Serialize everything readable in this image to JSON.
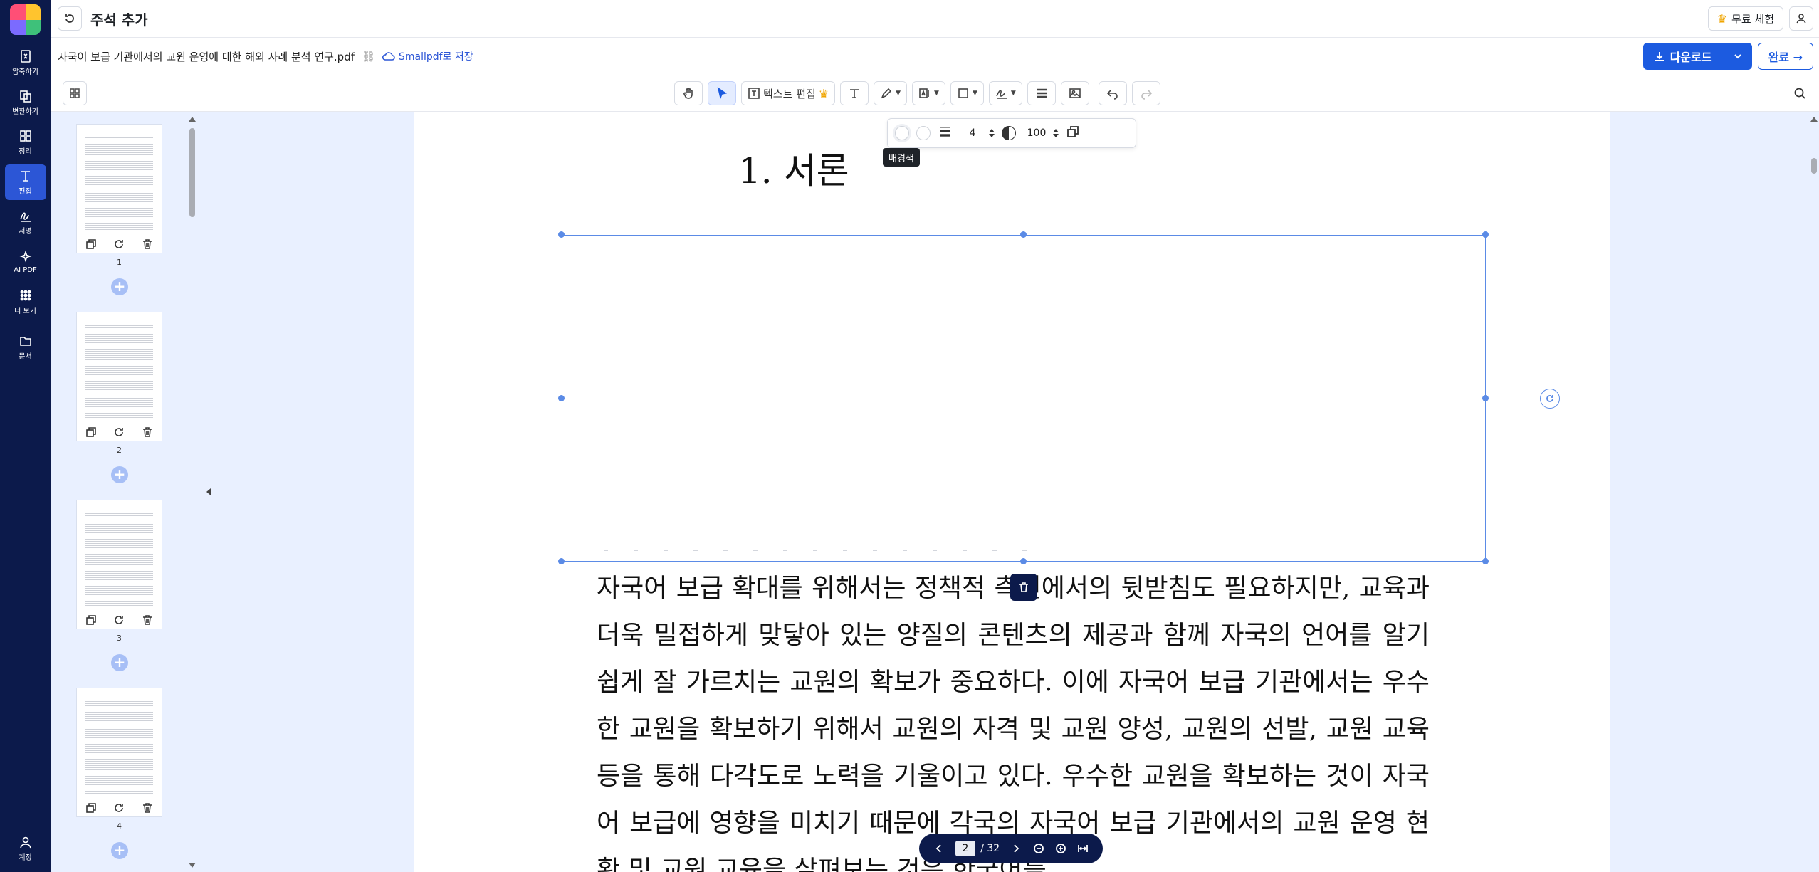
{
  "app": {
    "title": "주석 추가",
    "trial_label": "무료 체험"
  },
  "nav": {
    "items": [
      {
        "label": "압축하기",
        "icon": "compress-icon"
      },
      {
        "label": "변환하기",
        "icon": "convert-icon"
      },
      {
        "label": "정리",
        "icon": "organize-icon"
      },
      {
        "label": "편집",
        "icon": "edit-icon",
        "active": true
      },
      {
        "label": "서명",
        "icon": "sign-icon"
      },
      {
        "label": "AI PDF",
        "icon": "ai-icon"
      },
      {
        "label": "더 보기",
        "icon": "more-icon"
      },
      {
        "label": "문서",
        "icon": "folder-icon"
      }
    ],
    "account_label": "계정"
  },
  "file": {
    "name": "자국어 보급 기관에서의 교원 운영에 대한 해외 사례 분석 연구.pdf",
    "save_label": "Smallpdf로 저장",
    "download_label": "다운로드",
    "done_label": "완료 →"
  },
  "toolbar": {
    "edit_text_label": "텍스트 편집"
  },
  "style_bar": {
    "stroke_width": "4",
    "opacity": "100",
    "tooltip": "배경색"
  },
  "thumbnails": [
    {
      "number": "1"
    },
    {
      "number": "2"
    },
    {
      "number": "3"
    },
    {
      "number": "4"
    }
  ],
  "document": {
    "heading": "1.  서론",
    "paragraph": "자국어 보급 확대를 위해서는 정책적 측면에서의 뒷받침도 필요하지만, 교육과 더욱 밀접하게 맞닿아 있는 양질의 콘텐츠의 제공과 함께 자국의 언어를 알기 쉽게 잘 가르치는 교원의 확보가 중요하다. 이에 자국어 보급 기관에서는 우수한 교원을 확보하기 위해서 교원의 자격 및 교원 양성, 교원의 선발, 교원 교육 등을 통해 다각도로 노력을 기울이고 있다. 우수한 교원을 확보하는 것이 자국어 보급에 영향을 미치기 때문에 각국의 자국어 보급 기관에서의 교원 운영 현황 및 교원 교육을 살펴보는 것은 한국어를"
  },
  "pager": {
    "current": "2",
    "total": "/ 32"
  },
  "colors": {
    "rail": "#0c1a4b",
    "accent": "#1c5be0",
    "selection": "#5b8be6",
    "canvas_bg": "#e9f0ff"
  }
}
